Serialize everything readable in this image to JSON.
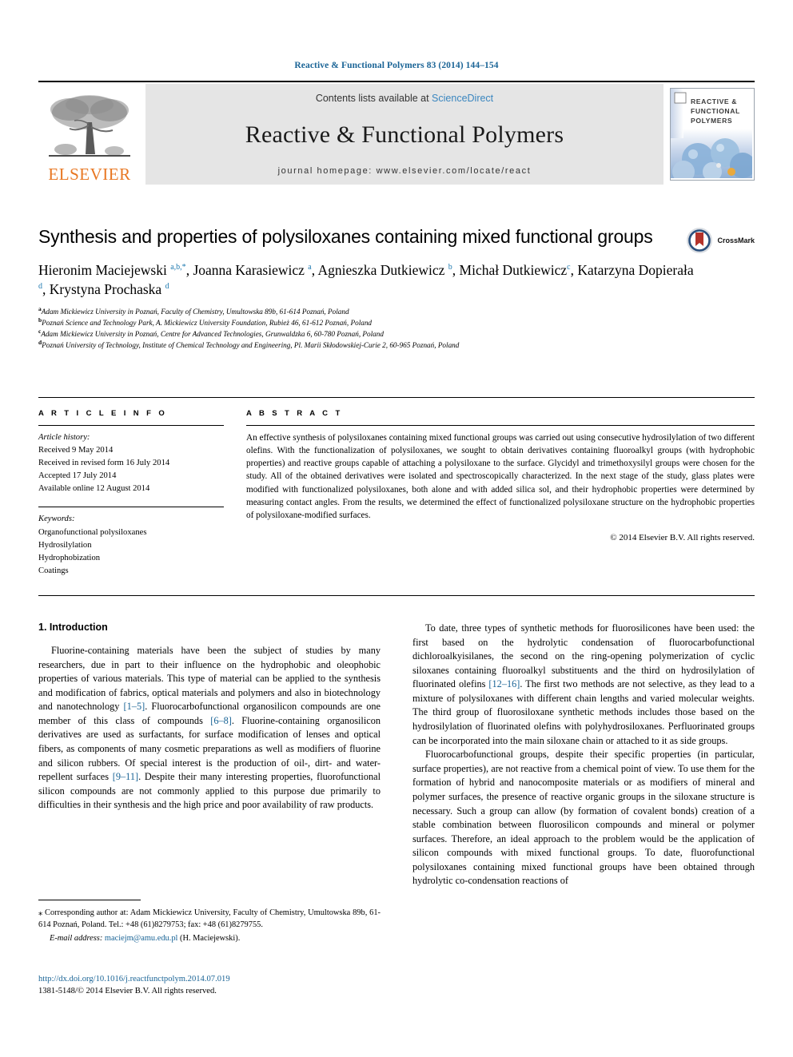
{
  "running_head": "Reactive & Functional Polymers 83 (2014) 144–154",
  "masthead": {
    "publisher_logo_text": "ELSEVIER",
    "contents_prefix": "Contents lists available at ",
    "contents_link": "ScienceDirect",
    "journal_title": "Reactive & Functional Polymers",
    "homepage_line": "journal homepage: www.elsevier.com/locate/react",
    "cover_line1": "REACTIVE &",
    "cover_line2": "FUNCTIONAL",
    "cover_line3": "POLYMERS"
  },
  "article": {
    "title": "Synthesis and properties of polysiloxanes containing mixed functional groups",
    "crossmark_label": "CrossMark",
    "authors_html": "Hieronim Maciejewski <sup>a,b,*</sup>, Joanna Karasiewicz <sup>a</sup>, Agnieszka Dutkiewicz <sup>b</sup>, Michał Dutkiewicz<sup>c</sup>, Katarzyna Dopierała <sup>d</sup>, Krystyna Prochaska <sup>d</sup>",
    "affiliations": [
      {
        "mark": "a",
        "text": "Adam Mickiewicz University in Poznań, Faculty of Chemistry, Umultowska 89b, 61-614 Poznań, Poland"
      },
      {
        "mark": "b",
        "text": "Poznań Science and Technology Park, A. Mickiewicz University Foundation, Rubież 46, 61-612 Poznań, Poland"
      },
      {
        "mark": "c",
        "text": "Adam Mickiewicz University in Poznań, Centre for Advanced Technologies, Grunwaldzka 6, 60-780 Poznań, Poland"
      },
      {
        "mark": "d",
        "text": "Poznań University of Technology, Institute of Chemical Technology and Engineering, Pl. Marii Skłodowskiej-Curie 2, 60-965 Poznań, Poland"
      }
    ]
  },
  "article_info": {
    "heading": "A R T I C L E   I N F O",
    "history_label": "Article history:",
    "history": [
      "Received 9 May 2014",
      "Received in revised form 16 July 2014",
      "Accepted 17 July 2014",
      "Available online 12 August 2014"
    ],
    "keywords_label": "Keywords:",
    "keywords": [
      "Organofunctional polysiloxanes",
      "Hydrosilylation",
      "Hydrophobization",
      "Coatings"
    ]
  },
  "abstract": {
    "heading": "A B S T R A C T",
    "text": "An effective synthesis of polysiloxanes containing mixed functional groups was carried out using consecutive hydrosilylation of two different olefins. With the functionalization of polysiloxanes, we sought to obtain derivatives containing fluoroalkyl groups (with hydrophobic properties) and reactive groups capable of attaching a polysiloxane to the surface. Glycidyl and trimethoxysilyl groups were chosen for the study. All of the obtained derivatives were isolated and spectroscopically characterized. In the next stage of the study, glass plates were modified with functionalized polysiloxanes, both alone and with added silica sol, and their hydrophobic properties were determined by measuring contact angles. From the results, we determined the effect of functionalized polysiloxane structure on the hydrophobic properties of polysiloxane-modified surfaces.",
    "copyright": "© 2014 Elsevier B.V. All rights reserved."
  },
  "body": {
    "section_heading": "1. Introduction",
    "left_paragraphs": [
      "Fluorine-containing materials have been the subject of studies by many researchers, due in part to their influence on the hydrophobic and oleophobic properties of various materials. This type of material can be applied to the synthesis and modification of fabrics, optical materials and polymers and also in biotechnology and nanotechnology [1–5]. Fluorocarbofunctional organosilicon compounds are one member of this class of compounds [6–8]. Fluorine-containing organosilicon derivatives are used as surfactants, for surface modification of lenses and optical fibers, as components of many cosmetic preparations as well as modifiers of fluorine and silicon rubbers. Of special interest is the production of oil-, dirt- and water-repellent surfaces [9–11]. Despite their many interesting properties, fluorofunctional silicon compounds are not commonly applied to this purpose due primarily to difficulties in their synthesis and the high price and poor availability of raw products."
    ],
    "right_paragraphs": [
      "To date, three types of synthetic methods for fluorosilicones have been used: the first based on the hydrolytic condensation of fluorocarbofunctional dichloroalkyisilanes, the second on the ring-opening polymerization of cyclic siloxanes containing fluoroalkyl substituents and the third on hydrosilylation of fluorinated olefins [12–16]. The first two methods are not selective, as they lead to a mixture of polysiloxanes with different chain lengths and varied molecular weights. The third group of fluorosiloxane synthetic methods includes those based on the hydrosilylation of fluorinated olefins with polyhydrosiloxanes. Perfluorinated groups can be incorporated into the main siloxane chain or attached to it as side groups.",
      "Fluorocarbofunctional groups, despite their specific properties (in particular, surface properties), are not reactive from a chemical point of view. To use them for the formation of hybrid and nanocomposite materials or as modifiers of mineral and polymer surfaces, the presence of reactive organic groups in the siloxane structure is necessary. Such a group can allow (by formation of covalent bonds) creation of a stable combination between fluorosilicon compounds and mineral or polymer surfaces. Therefore, an ideal approach to the problem would be the application of silicon compounds with mixed functional groups. To date, fluorofunctional polysiloxanes containing mixed functional groups have been obtained through hydrolytic co-condensation reactions of"
    ]
  },
  "footnote": {
    "corresponding": "⁎ Corresponding author at: Adam Mickiewicz University, Faculty of Chemistry, Umultowska 89b, 61-614 Poznań, Poland. Tel.: +48 (61)8279753; fax: +48 (61)8279755.",
    "email_label": "E-mail address:",
    "email": "maciejm@amu.edu.pl",
    "email_suffix": "(H. Maciejewski)."
  },
  "doi": {
    "url": "http://dx.doi.org/10.1016/j.reactfunctpolym.2014.07.019",
    "issn_line": "1381-5148/© 2014 Elsevier B.V. All rights reserved."
  },
  "colors": {
    "link": "#1a6496",
    "sciencedirect": "#3a86bf",
    "elsevier_orange": "#E87722",
    "ref_blue": "#1a6496",
    "band_gray": "#e5e5e5"
  }
}
